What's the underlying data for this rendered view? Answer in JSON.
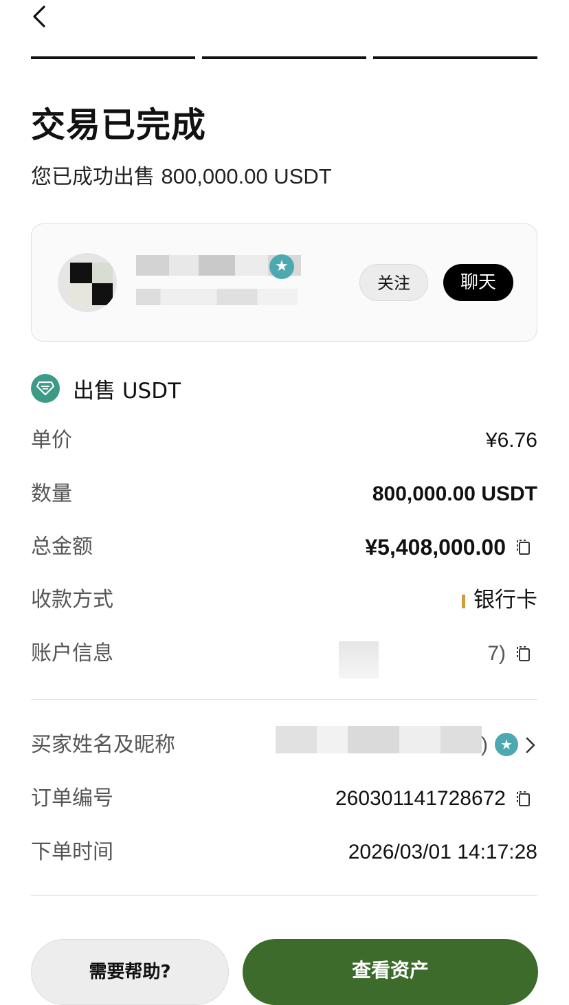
{
  "header": {
    "back_icon": "chevron-left-icon",
    "progress_steps": 3
  },
  "status": {
    "title": "交易已完成",
    "subtitle_prefix": "您已成功出售",
    "subtitle_amount": "800,000.00 USDT"
  },
  "counterparty": {
    "follow_label": "关注",
    "chat_label": "聊天",
    "verified_icon": "star-badge-icon"
  },
  "order": {
    "section_title": "出售 USDT",
    "rows": {
      "price": {
        "label": "单价",
        "value": "¥6.76"
      },
      "quantity": {
        "label": "数量",
        "value": "800,000.00 USDT"
      },
      "total": {
        "label": "总金额",
        "value": "¥5,408,000.00"
      },
      "payment": {
        "label": "收款方式",
        "value": "银行卡"
      },
      "account": {
        "label": "账户信息",
        "value": "7)"
      },
      "buyer": {
        "label": "买家姓名及昵称",
        "value": ")"
      },
      "order_no": {
        "label": "订单编号",
        "value": "260301141728672"
      },
      "time": {
        "label": "下单时间",
        "value": "2026/03/01 14:17:28"
      }
    }
  },
  "actions": {
    "help_label": "需要帮助?",
    "assets_label": "查看资产"
  },
  "colors": {
    "primary_button": "#3d6b2c",
    "coin_icon": "#3d9a87",
    "badge": "#4da9b0",
    "bank_mark": "#d39b3c"
  }
}
